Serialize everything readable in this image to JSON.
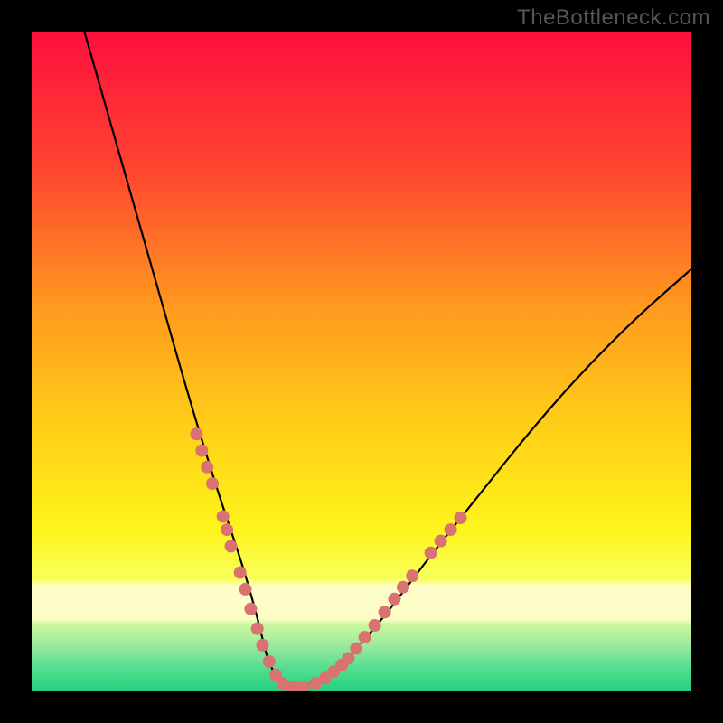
{
  "watermark": "TheBottleneck.com",
  "colors": {
    "bg_top": "#ff0f3e",
    "bg_mid1": "#ff6a2a",
    "bg_mid2": "#ffc815",
    "bg_mid3": "#fff31a",
    "bg_band": "#fdfdc7",
    "bg_green": "#2bd784",
    "curve": "#000000",
    "dots": "#da7272"
  },
  "chart_data": {
    "type": "line",
    "title": "",
    "xlabel": "",
    "ylabel": "",
    "xlim": [
      0,
      100
    ],
    "ylim": [
      0,
      100
    ],
    "series": [
      {
        "name": "curve",
        "x": [
          8,
          12,
          16,
          20,
          24,
          28,
          30,
          32,
          34,
          35,
          36,
          38,
          40,
          44,
          48,
          54,
          60,
          68,
          76,
          84,
          92,
          100
        ],
        "y": [
          100,
          86,
          72,
          58,
          44,
          31,
          25,
          19,
          12,
          8,
          4,
          1,
          0.5,
          1.5,
          5,
          12,
          20,
          30,
          40,
          49,
          57,
          64
        ]
      }
    ],
    "markers": [
      {
        "x": 25.0,
        "y": 39.0
      },
      {
        "x": 25.8,
        "y": 36.5
      },
      {
        "x": 26.6,
        "y": 34.0
      },
      {
        "x": 27.4,
        "y": 31.5
      },
      {
        "x": 29.0,
        "y": 26.5
      },
      {
        "x": 29.6,
        "y": 24.5
      },
      {
        "x": 30.2,
        "y": 22.0
      },
      {
        "x": 31.6,
        "y": 18.0
      },
      {
        "x": 32.4,
        "y": 15.5
      },
      {
        "x": 33.2,
        "y": 12.5
      },
      {
        "x": 34.2,
        "y": 9.5
      },
      {
        "x": 35.0,
        "y": 7.0
      },
      {
        "x": 36.0,
        "y": 4.5
      },
      {
        "x": 37.0,
        "y": 2.5
      },
      {
        "x": 38.0,
        "y": 1.2
      },
      {
        "x": 39.0,
        "y": 0.7
      },
      {
        "x": 40.0,
        "y": 0.5
      },
      {
        "x": 41.2,
        "y": 0.6
      },
      {
        "x": 43.0,
        "y": 1.2
      },
      {
        "x": 44.5,
        "y": 2.0
      },
      {
        "x": 45.8,
        "y": 3.0
      },
      {
        "x": 47.0,
        "y": 4.0
      },
      {
        "x": 48.0,
        "y": 5.0
      },
      {
        "x": 49.2,
        "y": 6.5
      },
      {
        "x": 50.5,
        "y": 8.2
      },
      {
        "x": 52.0,
        "y": 10.0
      },
      {
        "x": 53.5,
        "y": 12.0
      },
      {
        "x": 55.0,
        "y": 14.0
      },
      {
        "x": 56.3,
        "y": 15.8
      },
      {
        "x": 57.7,
        "y": 17.5
      },
      {
        "x": 60.5,
        "y": 21.0
      },
      {
        "x": 62.0,
        "y": 22.8
      },
      {
        "x": 63.5,
        "y": 24.5
      },
      {
        "x": 65.0,
        "y": 26.3
      }
    ]
  }
}
